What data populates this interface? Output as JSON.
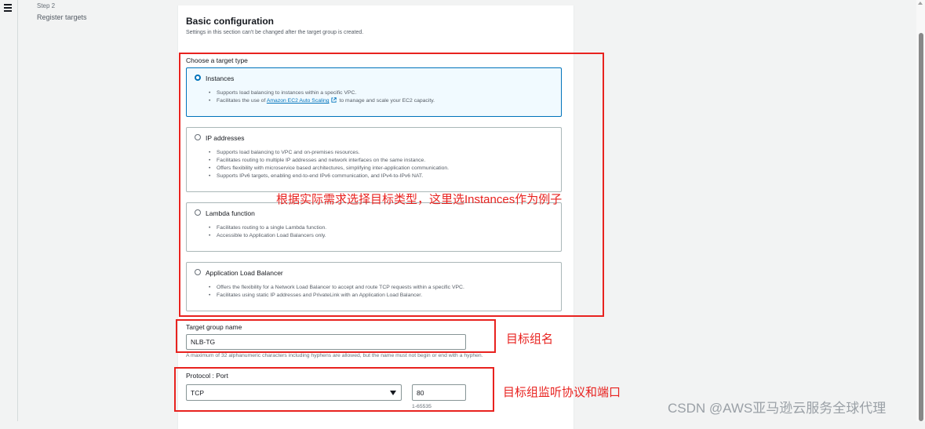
{
  "nav": {
    "step_label": "Step 2",
    "step_name": "Register targets"
  },
  "section": {
    "title": "Basic configuration",
    "description": "Settings in this section can't be changed after the target group is created."
  },
  "target_type": {
    "label": "Choose a target type",
    "selected": "Instances",
    "options": [
      {
        "title": "Instances",
        "bullets": [
          "Supports load balancing to instances within a specific VPC."
        ],
        "bullet2_prefix": "Facilitates the use of ",
        "bullet2_link": "Amazon EC2 Auto Scaling",
        "bullet2_suffix": " to manage and scale your EC2 capacity."
      },
      {
        "title": "IP addresses",
        "bullets": [
          "Supports load balancing to VPC and on-premises resources.",
          "Facilitates routing to multiple IP addresses and network interfaces on the same instance.",
          "Offers flexibility with microservice based architectures, simplifying inter-application communication.",
          "Supports IPv6 targets, enabling end-to-end IPv6 communication, and IPv4-to-IPv6 NAT."
        ]
      },
      {
        "title": "Lambda function",
        "bullets": [
          "Facilitates routing to a single Lambda function.",
          "Accessible to Application Load Balancers only."
        ]
      },
      {
        "title": "Application Load Balancer",
        "bullets": [
          "Offers the flexibility for a Network Load Balancer to accept and route TCP requests within a specific VPC.",
          "Facilitates using static IP addresses and PrivateLink with an Application Load Balancer."
        ]
      }
    ]
  },
  "target_group_name": {
    "label": "Target group name",
    "value": "NLB-TG",
    "hint": "A maximum of 32 alphanumeric characters including hyphens are allowed, but the name must not begin or end with a hyphen."
  },
  "protocol_port": {
    "label": "Protocol : Port",
    "protocol": "TCP",
    "port": "80",
    "port_hint": "1-65535"
  },
  "annotations": {
    "target_type_note": "根据实际需求选择目标类型，这里选Instances作为例子",
    "name_note": "目标组名",
    "protocol_note": "目标组监听协议和端口"
  },
  "watermark": "CSDN @AWS亚马逊云服务全球代理",
  "colors": {
    "accent": "#0073bb",
    "annotation": "#e8221f",
    "selected_bg": "#f1faff"
  }
}
